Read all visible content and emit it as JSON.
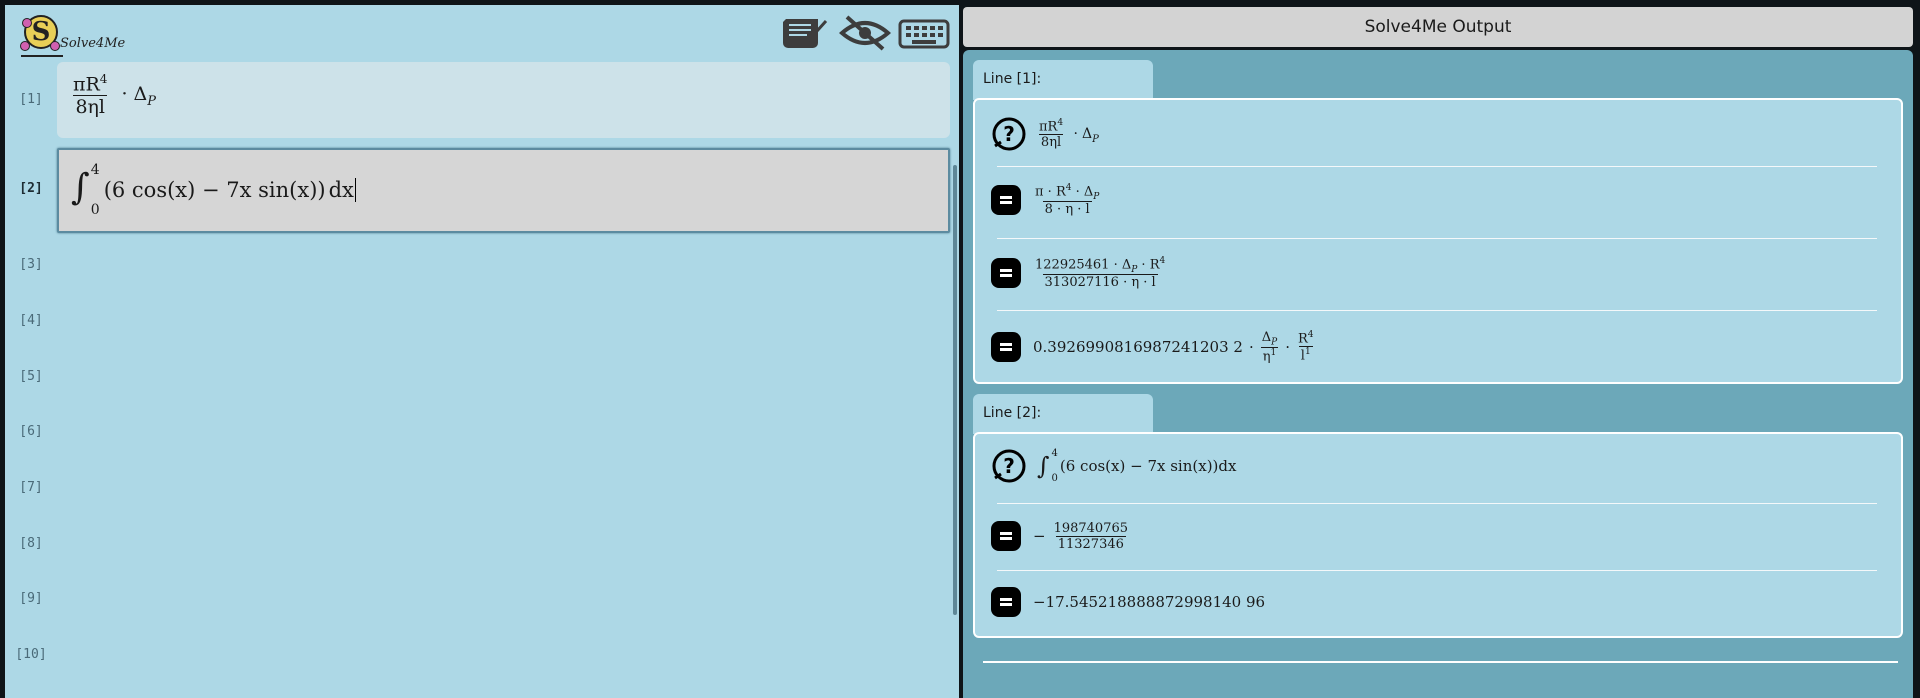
{
  "app": {
    "name": "Solve4Me"
  },
  "toolbar": {
    "icons": [
      "scroll-icon",
      "eye-off-icon",
      "keyboard-icon"
    ]
  },
  "editor": {
    "line_numbers": [
      "[1]",
      "[2]",
      "[3]",
      "[4]",
      "[5]",
      "[6]",
      "[7]",
      "[8]",
      "[9]",
      "[10]"
    ],
    "active_line": "[2]",
    "line1": {
      "num": "πR",
      "sup": "4",
      "den": "8ηl",
      "op": "·",
      "delta": "Δ",
      "sub": "P"
    },
    "line2": {
      "lower": "0",
      "upper": "4",
      "body": "(6 cos(x) − 7x sin(x))",
      "dx": "dx"
    }
  },
  "output": {
    "title": "Solve4Me Output",
    "lines": [
      {
        "tab": "Line [1]:",
        "input": {
          "num": "πR",
          "sup": "4",
          "den": "8ηl",
          "op": "·",
          "delta": "Δ",
          "sub": "P"
        },
        "result1": {
          "num": "π · R",
          "sup": "4",
          "num2": " · Δ",
          "sub": "P",
          "den": "8 · η · l"
        },
        "result2": {
          "num": "122925461 · Δ",
          "sub": "P",
          "num2": " · R",
          "sup": "4",
          "den": "313027116 · η · l"
        },
        "result3": {
          "coef": "0.3926990816987241203 2",
          "f1_num": "Δ",
          "f1_sub": "P",
          "f1_den": "η",
          "f1_den_sup": "1",
          "f2_num": "R",
          "f2_sup": "4",
          "f2_den": "l",
          "f2_den_sup": "1",
          "op": "·"
        }
      },
      {
        "tab": "Line [2]:",
        "input": {
          "lower": "0",
          "upper": "4",
          "body": "(6 cos(x) − 7x sin(x))",
          "dx": "dx"
        },
        "result1": {
          "sign": "−",
          "num": "198740765",
          "den": "11327346"
        },
        "result2": {
          "value": "−17.545218888872998140 96"
        }
      }
    ]
  },
  "colors": {
    "editor_bg": "#add8e6",
    "output_bg": "#6ca8b9",
    "active_line_bg": "#d6d6d6",
    "header_bg": "#d3d3d3"
  }
}
